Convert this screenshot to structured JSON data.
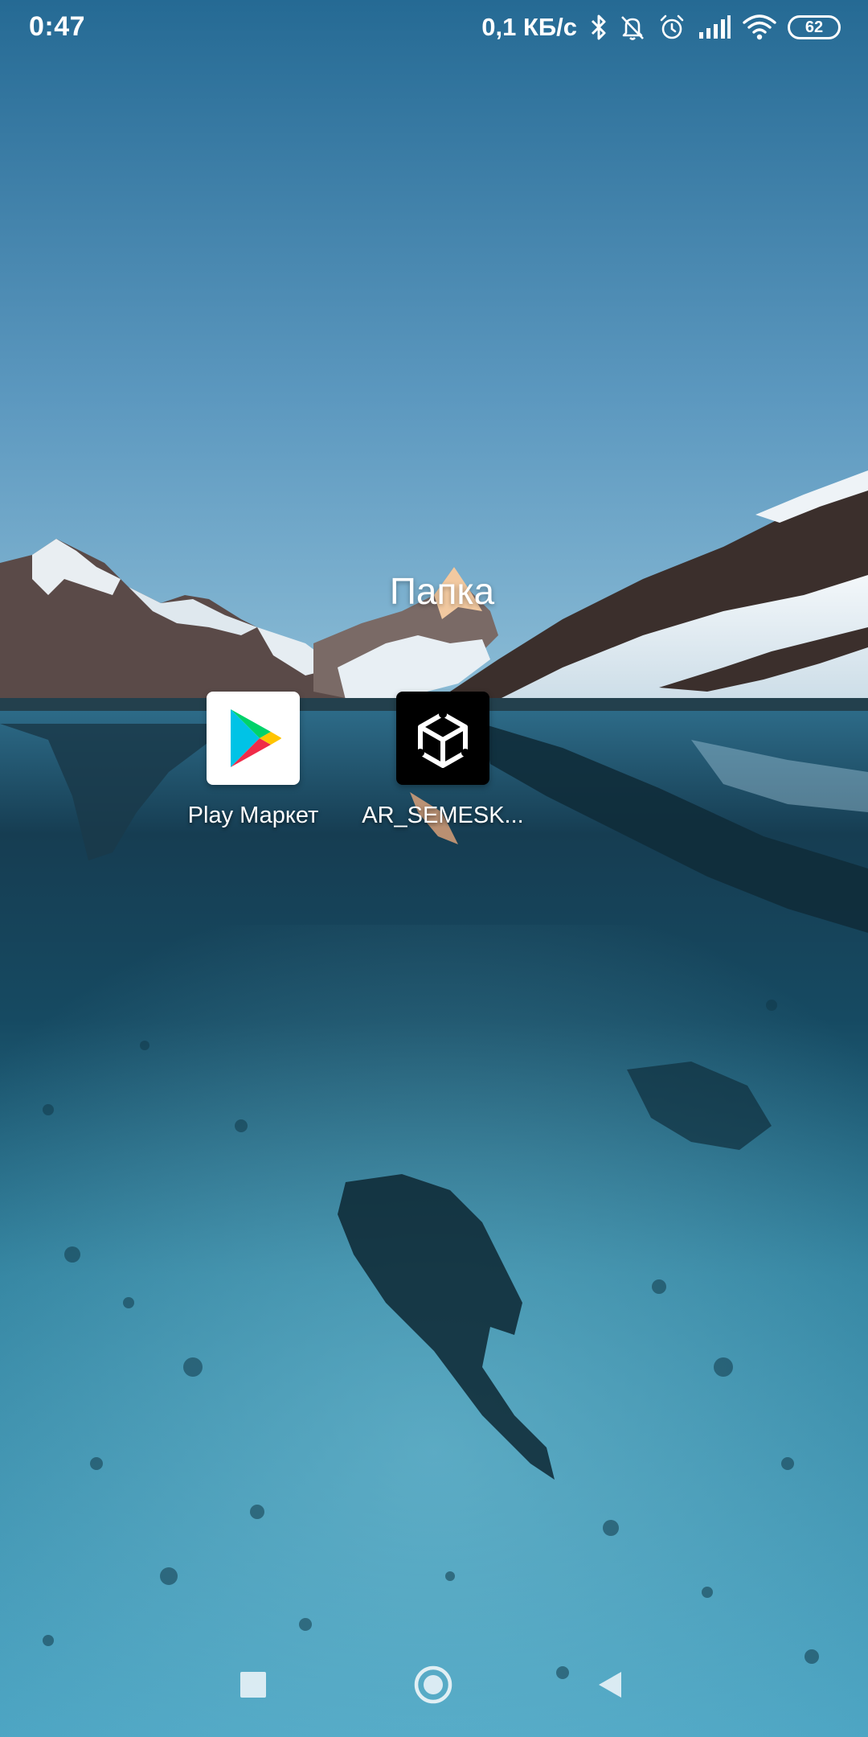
{
  "status_bar": {
    "time": "0:47",
    "net_speed": "0,1 КБ/с",
    "battery_level": "62",
    "icons": [
      "bluetooth-icon",
      "mute-bell-icon",
      "alarm-icon",
      "signal-icon",
      "wifi-icon",
      "battery-icon"
    ]
  },
  "folder": {
    "title": "Папка",
    "apps": [
      {
        "label": "Play Маркет",
        "icon": "play-store-icon"
      },
      {
        "label": "AR_SEMESK...",
        "icon": "unity-icon"
      }
    ]
  },
  "nav_bar": {
    "buttons": [
      "recent-apps",
      "home",
      "back"
    ]
  },
  "colors": {
    "sky_top": "#2a6c95",
    "sky_horizon": "#86b7d4",
    "water": "#12465e",
    "ice": "#5fb2ca"
  }
}
